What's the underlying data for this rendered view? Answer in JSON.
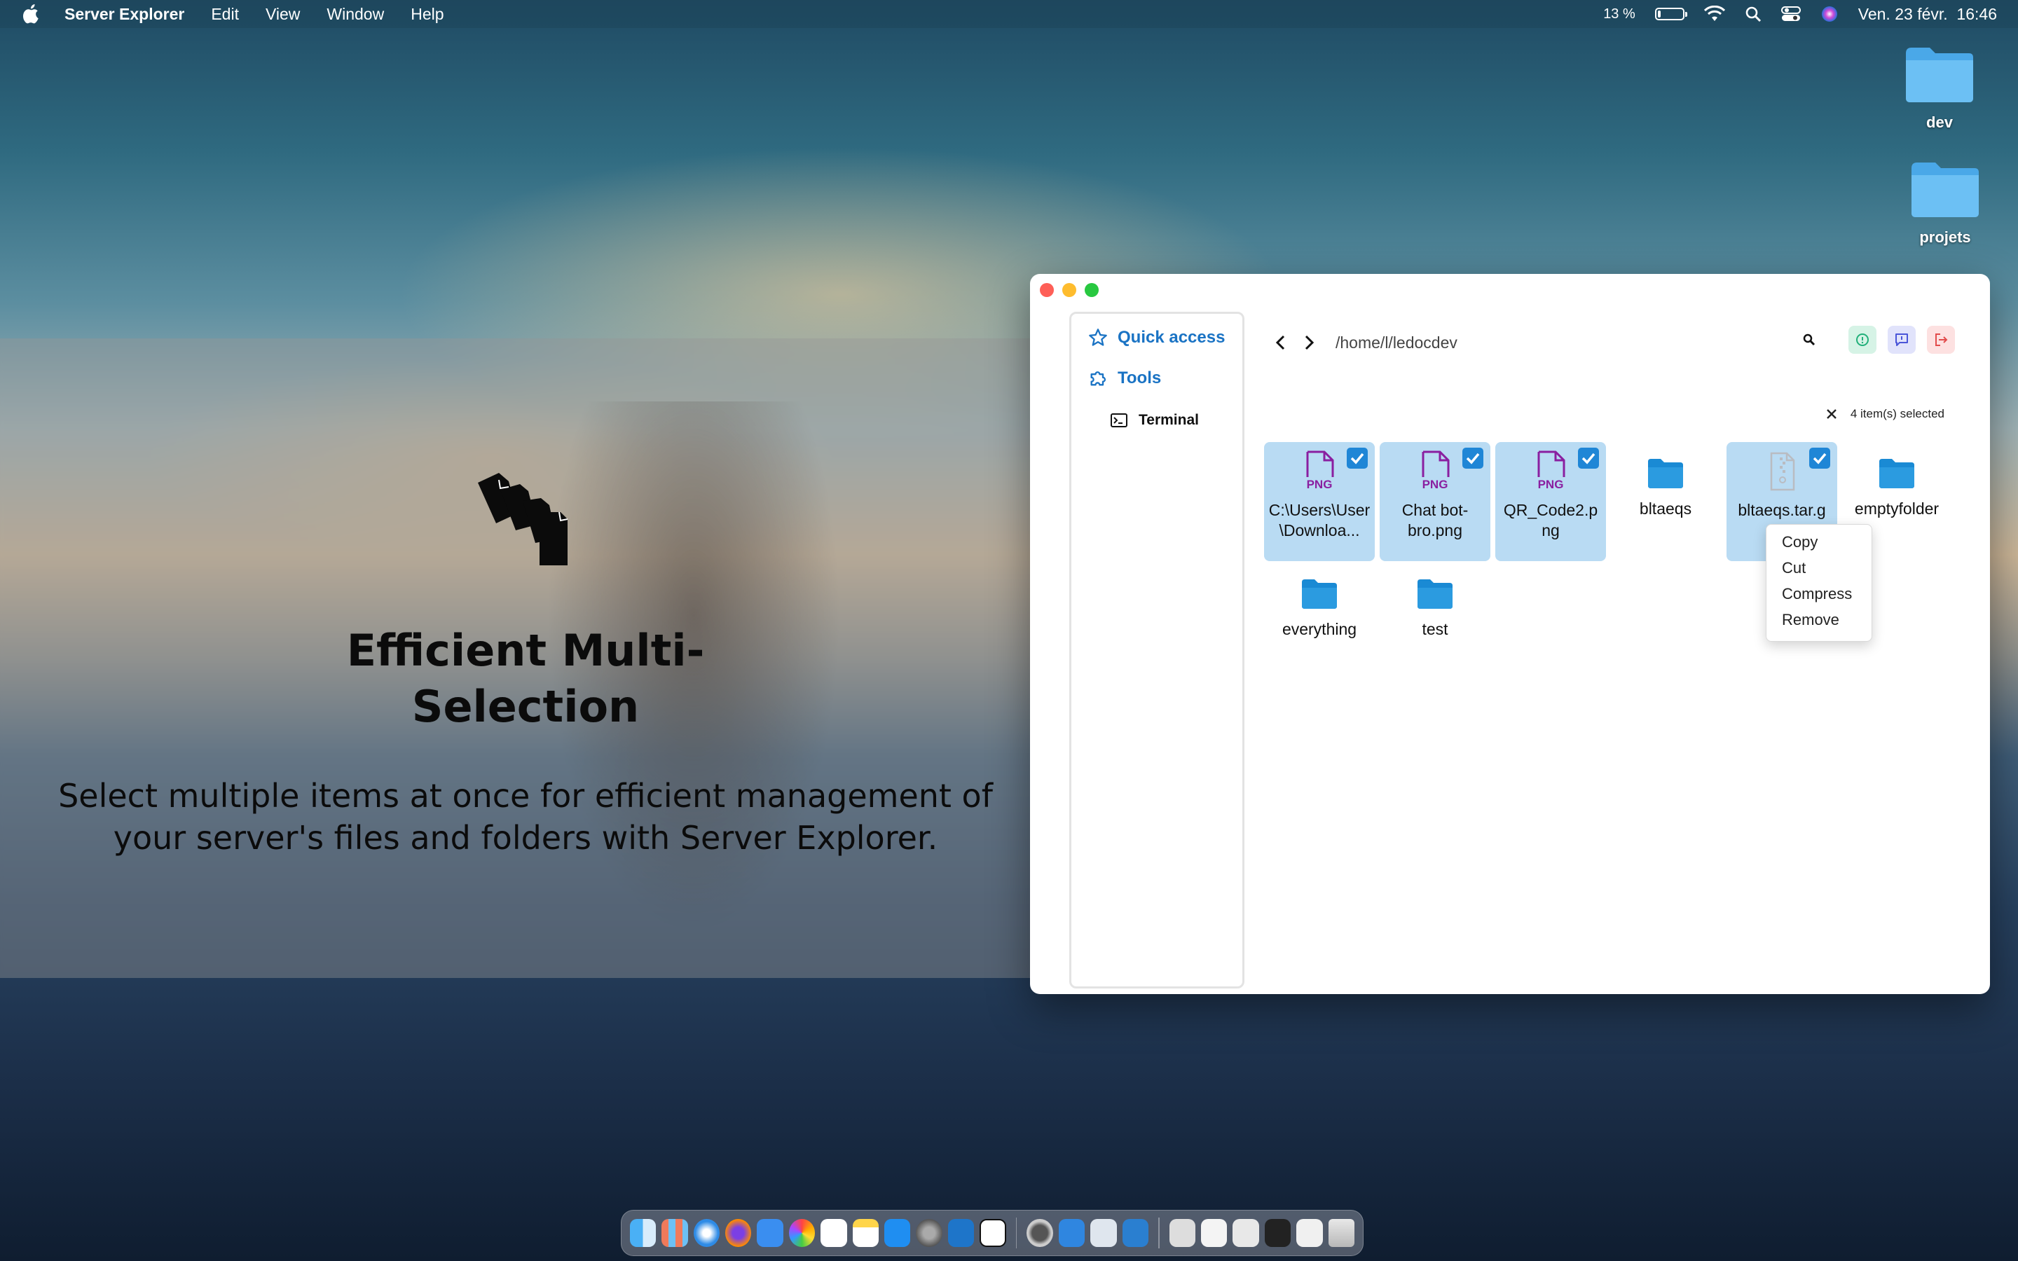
{
  "menubar": {
    "app_name": "Server Explorer",
    "menus": [
      "Edit",
      "View",
      "Window",
      "Help"
    ],
    "battery": "13 %",
    "datetime": "Ven. 23 févr.  16:46"
  },
  "desktop": {
    "icons": [
      "dev",
      "projets"
    ]
  },
  "promo": {
    "title": "Efficient Multi-Selection",
    "description": "Select multiple items at once for efficient management of your server's files and folders with Server Explorer."
  },
  "window": {
    "sidebar": {
      "quick_access": "Quick access",
      "tools": "Tools",
      "terminal": "Terminal"
    },
    "path": "/home/l/ledocdev",
    "selection_label": "4 item(s) selected",
    "files": [
      {
        "name": "C:\\Users\\User\\Downloa...",
        "type": "png",
        "selected": true,
        "badge": "PNG"
      },
      {
        "name": "Chat bot-bro.png",
        "type": "png",
        "selected": true,
        "badge": "PNG"
      },
      {
        "name": "QR_Code2.png",
        "type": "png",
        "selected": true,
        "badge": "PNG"
      },
      {
        "name": "bltaeqs",
        "type": "folder",
        "selected": false
      },
      {
        "name": "bltaeqs.tar.g",
        "type": "archive",
        "selected": true
      },
      {
        "name": "emptyfolder",
        "type": "folder",
        "selected": false
      },
      {
        "name": "everything",
        "type": "folder",
        "selected": false
      },
      {
        "name": "test",
        "type": "folder",
        "selected": false
      }
    ],
    "context_menu": [
      "Copy",
      "Cut",
      "Compress",
      "Remove"
    ]
  },
  "colors": {
    "accent": "#1a73c4",
    "selection": "#b9dbf3",
    "checkbox": "#1f86d6",
    "png_purple": "#8a1fa0",
    "folder_blue": "#1a8ad4"
  }
}
